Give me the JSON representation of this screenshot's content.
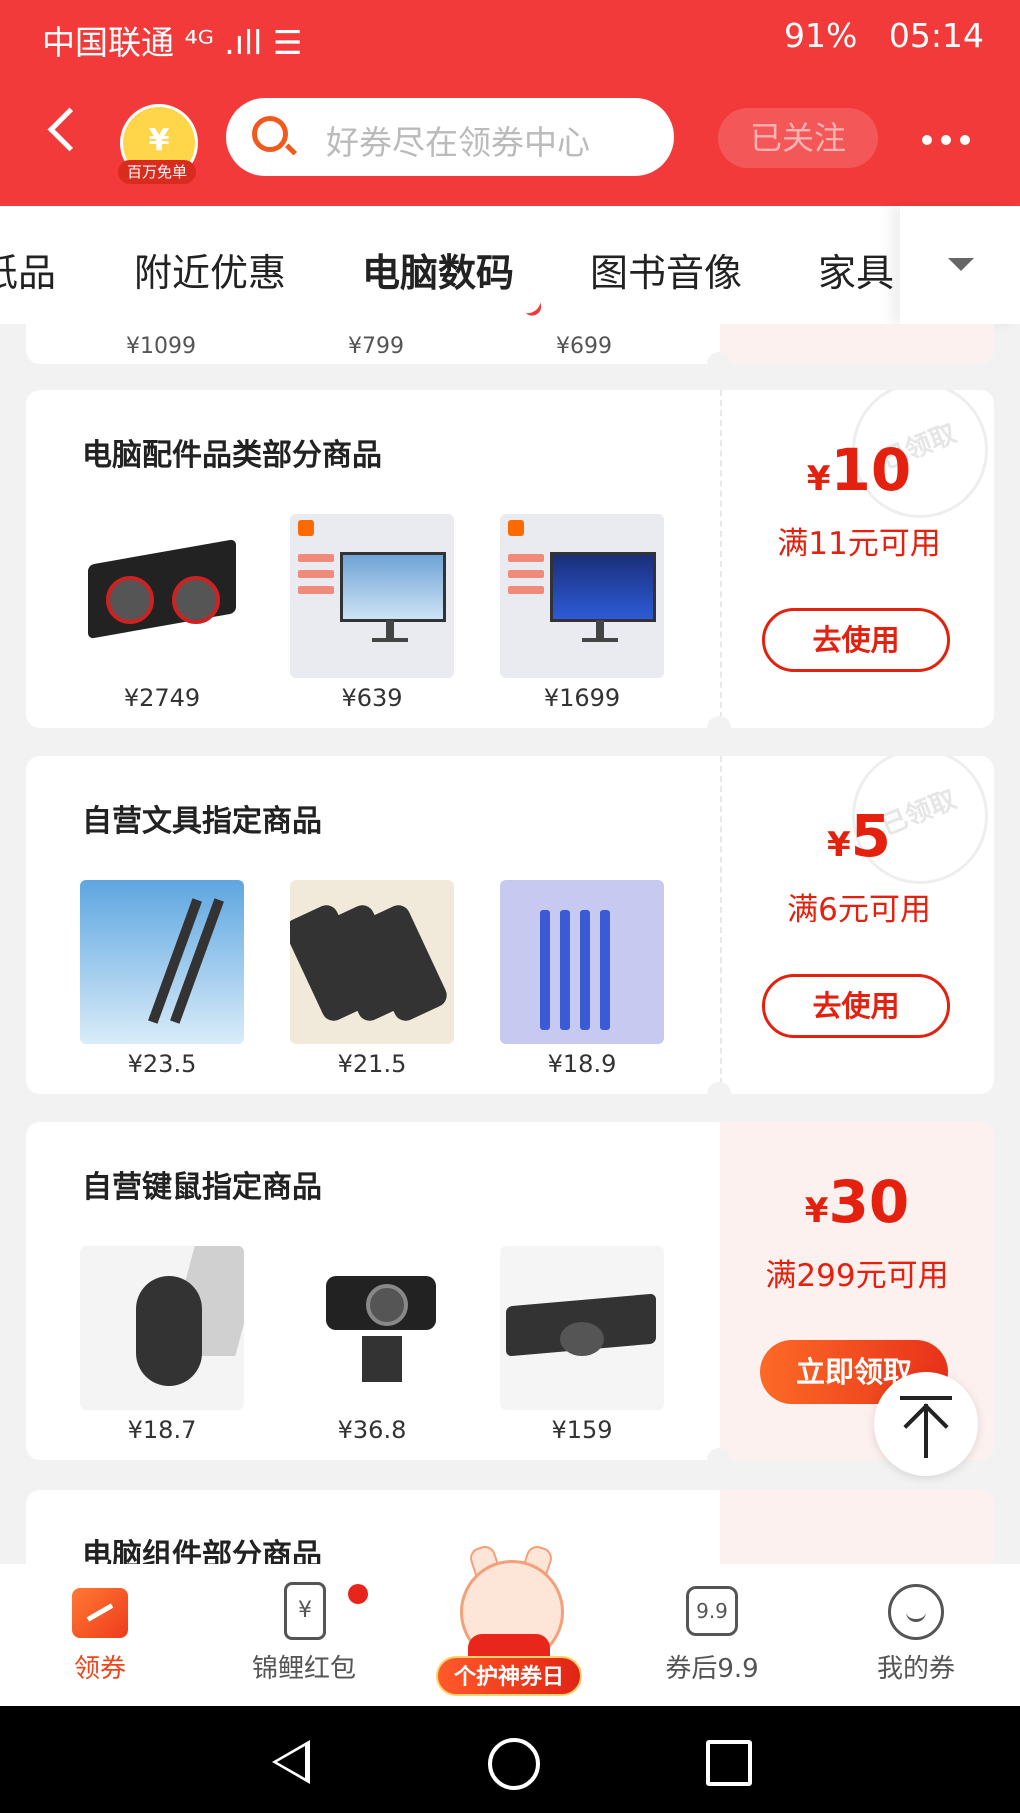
{
  "status_bar": {
    "carrier": "中国联通 ⁴ᴳ .ıll ☰",
    "battery": "91%",
    "time": "05:14"
  },
  "header": {
    "badge_label": "百万免单",
    "search_placeholder": "好券尽在领券中心",
    "follow_label": "已关注"
  },
  "tabs": [
    "纸品",
    "附近优惠",
    "电脑数码",
    "图书音像",
    "家具"
  ],
  "active_tab": "电脑数码",
  "top_partial_prices": [
    "¥1099",
    "¥799",
    "¥699"
  ],
  "coupons": [
    {
      "title": "电脑配件品类部分商品",
      "amount": "10",
      "currency": "¥",
      "condition": "满11元可用",
      "action": "去使用",
      "claimed": true,
      "stamp": "已领取",
      "products": [
        {
          "name": "graphics-card",
          "price": "¥2749"
        },
        {
          "name": "monitor",
          "price": "¥639"
        },
        {
          "name": "curved-monitor",
          "price": "¥1699"
        }
      ]
    },
    {
      "title": "自营文具指定商品",
      "amount": "5",
      "currency": "¥",
      "condition": "满6元可用",
      "action": "去使用",
      "claimed": true,
      "stamp": "已领取",
      "products": [
        {
          "name": "gel-pen",
          "price": "¥23.5"
        },
        {
          "name": "correction-tape",
          "price": "¥21.5"
        },
        {
          "name": "pencils",
          "price": "¥18.9"
        }
      ]
    },
    {
      "title": "自营键鼠指定商品",
      "amount": "30",
      "currency": "¥",
      "condition": "满299元可用",
      "action": "立即领取",
      "claimed": false,
      "products": [
        {
          "name": "mouse",
          "price": "¥18.7"
        },
        {
          "name": "webcam",
          "price": "¥36.8"
        },
        {
          "name": "keyboard-mouse-set",
          "price": "¥159"
        }
      ]
    }
  ],
  "partial_card_title": "电脑组件部分商品",
  "bottom_nav": {
    "items": [
      {
        "label": "领券",
        "icon": "coupon-icon"
      },
      {
        "label": "锦鲤红包",
        "icon": "red-packet-icon"
      },
      {
        "label": "个护神券日",
        "icon": "mascot-icon"
      },
      {
        "label": "券后9.9",
        "icon": "price-99-icon"
      },
      {
        "label": "我的券",
        "icon": "smile-icon"
      }
    ]
  },
  "icons": {
    "red_packet_glyph": "¥",
    "nine_nine_glyph": "9.9"
  },
  "colors": {
    "brand_red": "#f23a3a",
    "coupon_red": "#e4200e"
  }
}
